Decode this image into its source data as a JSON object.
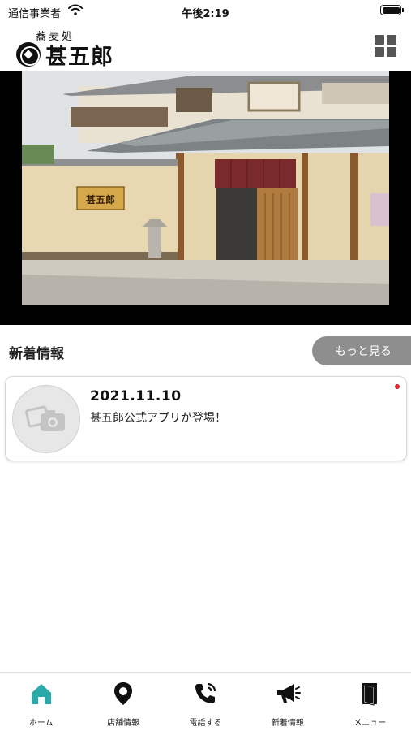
{
  "status_bar": {
    "carrier": "通信事業者",
    "time": "午後2:19"
  },
  "header": {
    "logo_sub": "蕎麦処",
    "logo_main": "甚五郎",
    "menu_icon": "grid-icon"
  },
  "hero": {
    "signboard_text": "甚五郎"
  },
  "news": {
    "section_title": "新着情報",
    "more_label": "もっと見る",
    "items": [
      {
        "date": "2021.11.10",
        "text": "甚五郎公式アプリが登場！",
        "thumbnail_icon": "camera-placeholder-icon",
        "unread": true
      }
    ]
  },
  "tab_bar": {
    "active_color": "#2aa9a9",
    "items": [
      {
        "label": "ホーム",
        "icon": "home-icon",
        "active": true
      },
      {
        "label": "店舗情報",
        "icon": "map-pin-icon",
        "active": false
      },
      {
        "label": "電話する",
        "icon": "phone-icon",
        "active": false
      },
      {
        "label": "新着情報",
        "icon": "megaphone-icon",
        "active": false
      },
      {
        "label": "メニュー",
        "icon": "book-icon",
        "active": false
      }
    ]
  },
  "colors": {
    "more_button": "#8e8e8e",
    "unread_dot": "#e0262a"
  }
}
